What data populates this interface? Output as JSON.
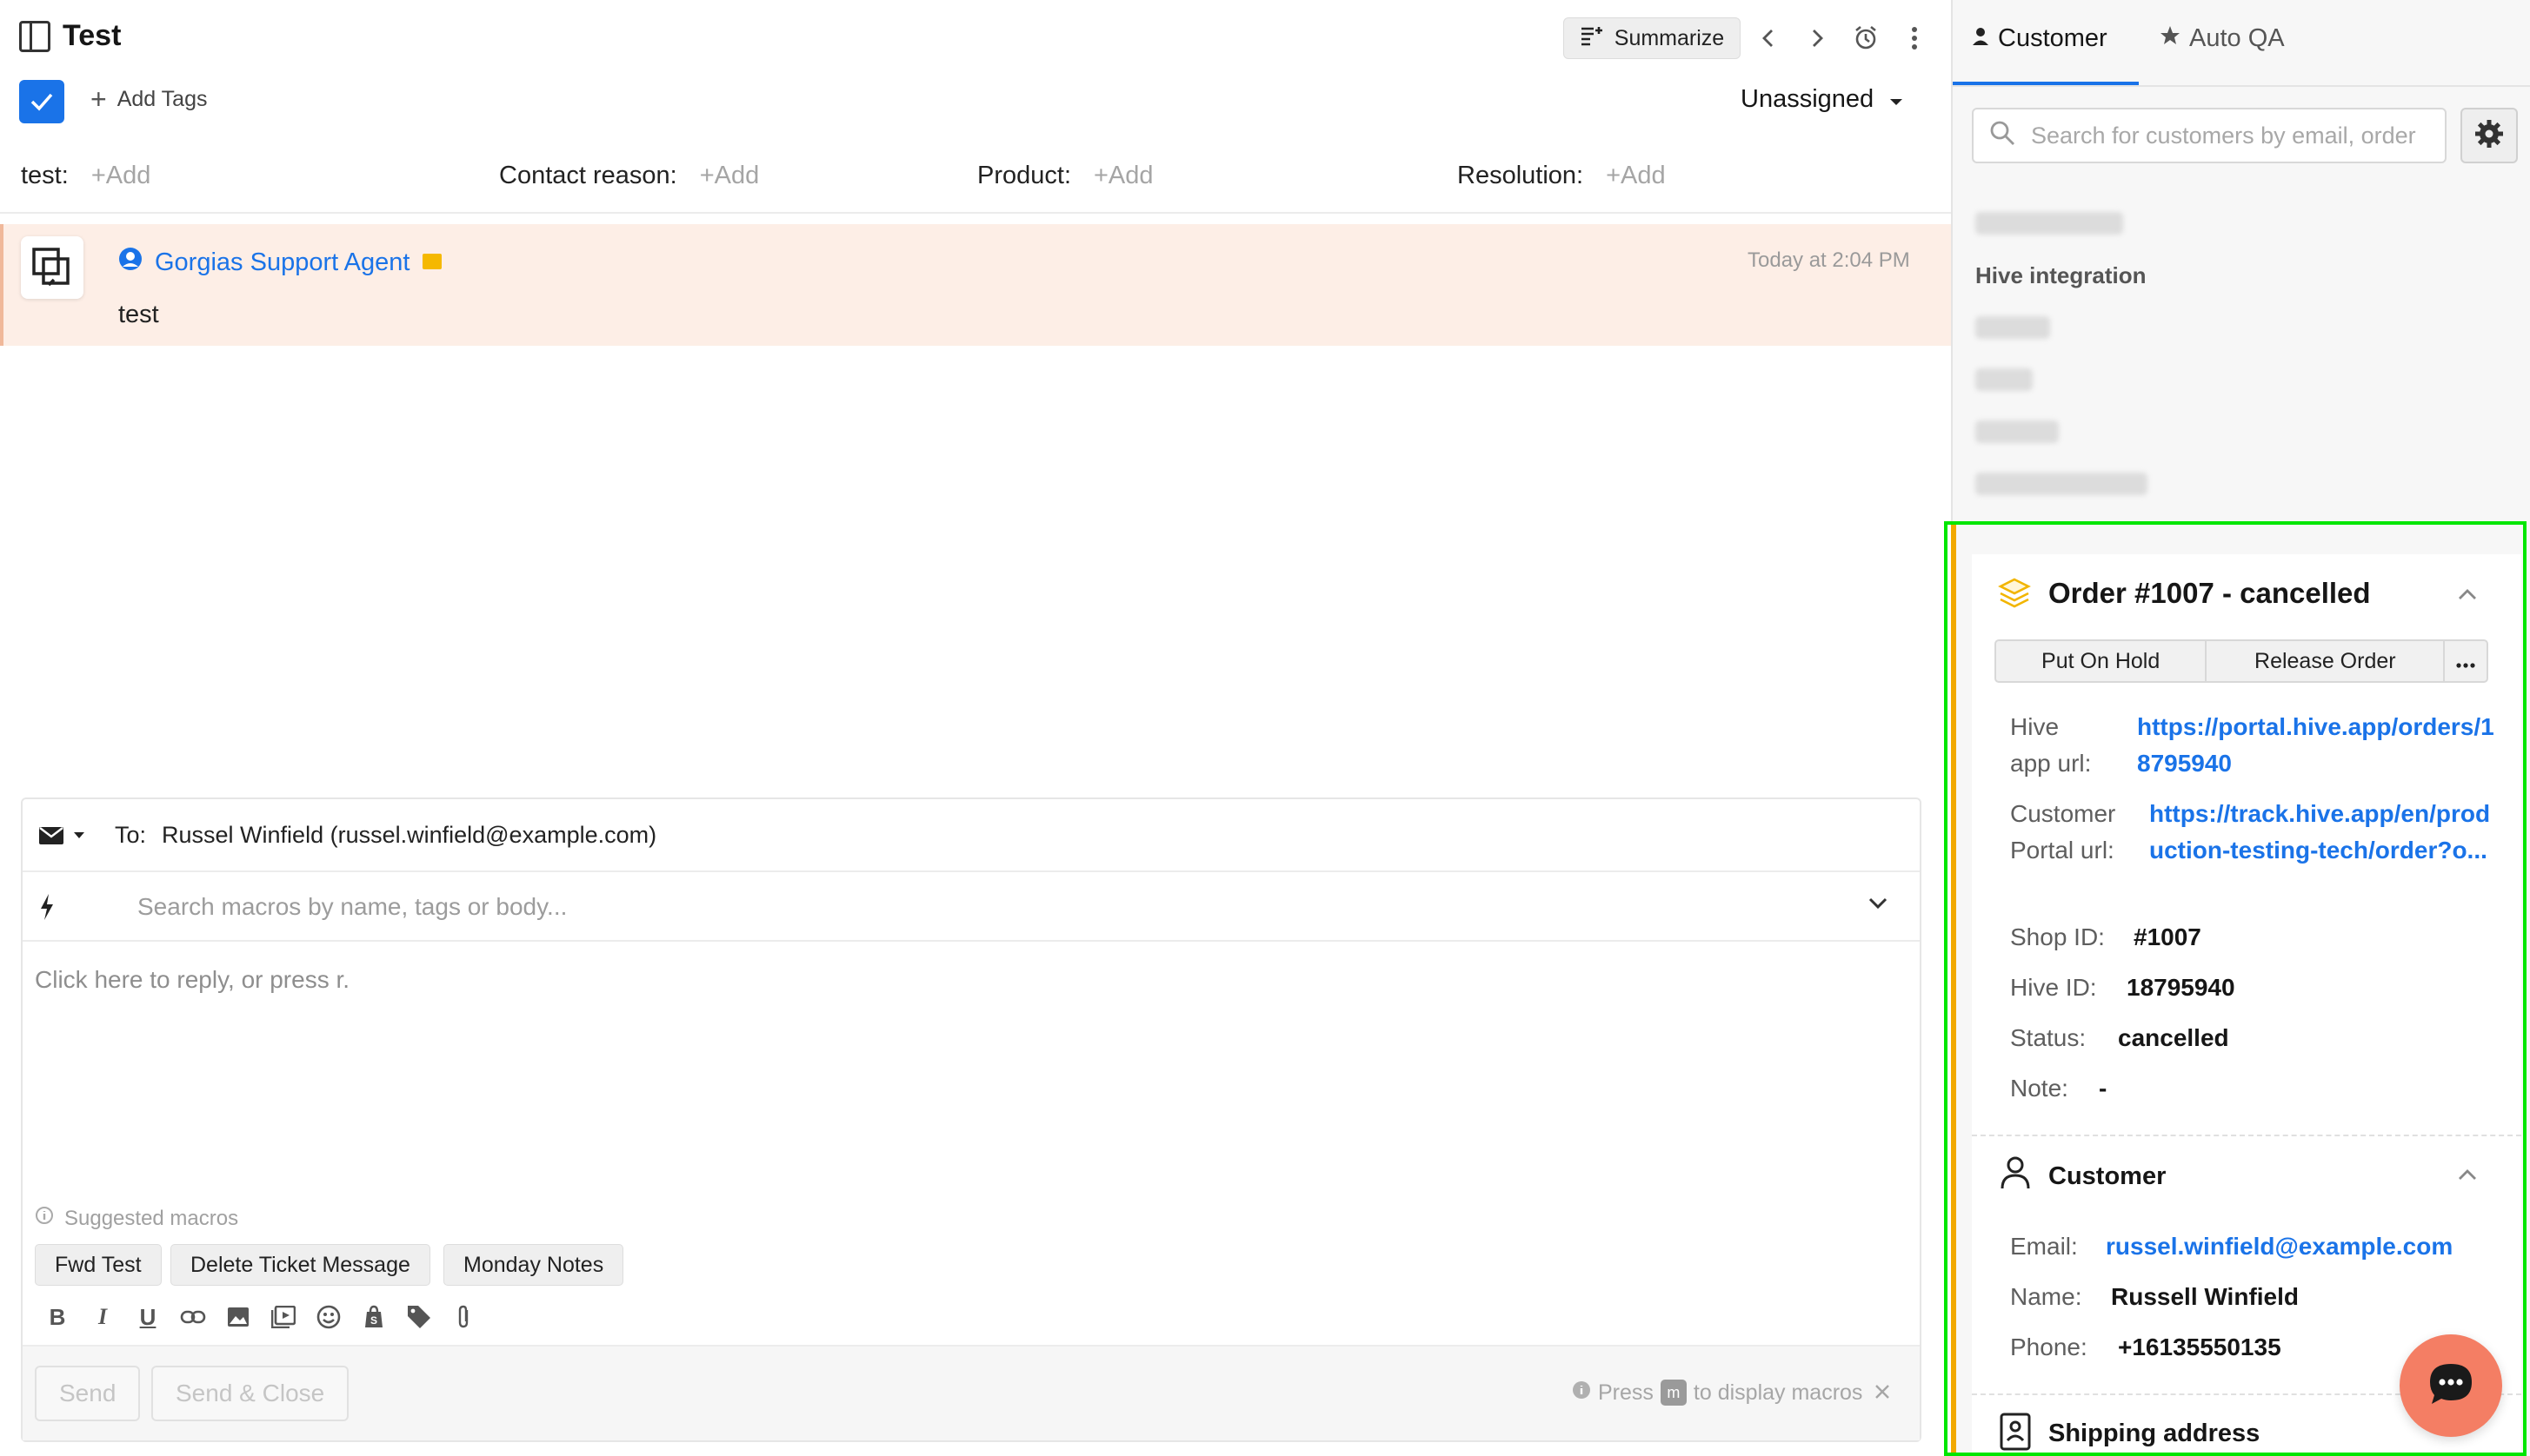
{
  "header": {
    "title": "Test",
    "summarize_label": "Summarize",
    "assignee": "Unassigned",
    "add_tags_label": "Add Tags"
  },
  "fields": [
    {
      "label": "test:",
      "placeholder": "+Add"
    },
    {
      "label": "Contact reason:",
      "placeholder": "+Add"
    },
    {
      "label": "Product:",
      "placeholder": "+Add"
    },
    {
      "label": "Resolution:",
      "placeholder": "+Add"
    }
  ],
  "message": {
    "author": "Gorgias Support Agent",
    "time": "Today at 2:04 PM",
    "body": "test"
  },
  "composer": {
    "to_label": "To:",
    "to_value": "Russel Winfield (russel.winfield@example.com)",
    "macro_search_placeholder": "Search macros by name, tags or body...",
    "reply_placeholder": "Click here to reply, or press r.",
    "suggested_label": "Suggested macros",
    "macros": [
      "Fwd Test",
      "Delete Ticket Message",
      "Monday Notes"
    ],
    "send_label": "Send",
    "send_close_label": "Send & Close",
    "press_label": "Press",
    "press_key": "m",
    "press_suffix": "to display macros"
  },
  "sidebar": {
    "tabs": [
      {
        "label": "Customer",
        "icon": "person-icon",
        "active": true
      },
      {
        "label": "Auto QA",
        "icon": "star-icon",
        "active": false
      }
    ],
    "search_placeholder": "Search for customers by email, order",
    "integration_label": "Hive integration",
    "order": {
      "title": "Order #1007 - cancelled",
      "actions": [
        "Put On Hold",
        "Release Order"
      ],
      "fields": [
        {
          "label": "Hive app url:",
          "value": "https://portal.hive.app/orders/18795940",
          "link": true
        },
        {
          "label": "Customer Portal url:",
          "value": "https://track.hive.app/en/production-testing-tech/order?o...",
          "link": true
        },
        {
          "label": "Shop ID:",
          "value": "#1007"
        },
        {
          "label": "Hive ID:",
          "value": "18795940"
        },
        {
          "label": "Status:",
          "value": "cancelled"
        },
        {
          "label": "Note:",
          "value": "-"
        }
      ]
    },
    "customer": {
      "title": "Customer",
      "fields": [
        {
          "label": "Email:",
          "value": "russel.winfield@example.com",
          "link": true
        },
        {
          "label": "Name:",
          "value": "Russell Winfield"
        },
        {
          "label": "Phone:",
          "value": "+16135550135"
        }
      ]
    },
    "shipping_title": "Shipping address"
  },
  "colors": {
    "accent": "#1a73e8",
    "message_bg": "#fdeee6",
    "widget_accent": "#f2a900",
    "chat_bubble": "#f47e64",
    "highlight_frame": "#00e600"
  }
}
